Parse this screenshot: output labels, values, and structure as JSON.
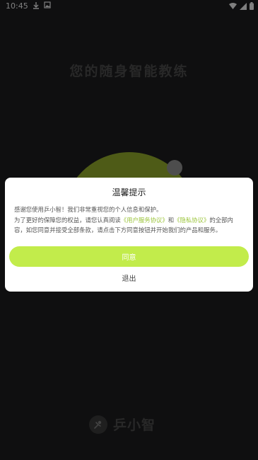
{
  "status_bar": {
    "time": "10:45",
    "left_icons": [
      "download-icon",
      "image-icon"
    ],
    "right_icons": [
      "wifi-icon",
      "signal-icon",
      "battery-icon"
    ]
  },
  "background": {
    "slogan": "您的随身智能教练",
    "circle_color": "#8ea62a",
    "brand_name": "乒小智"
  },
  "dialog": {
    "title": "温馨提示",
    "line1": "感谢您使用乒小智！我们非常重视您的个人信息和保护。",
    "line2_prefix": "为了更好的保障您的权益，请您认真阅读",
    "link_user_agreement": "《用户服务协议》",
    "and": "和",
    "link_privacy": "《隐私协议》",
    "line2_suffix": "的全部内容，如您同意并接受全部条款，请点击下方同意按钮并开始我们的产品和服务。",
    "agree_label": "同意",
    "exit_label": "退出",
    "accent_color": "#c2ec4b"
  }
}
